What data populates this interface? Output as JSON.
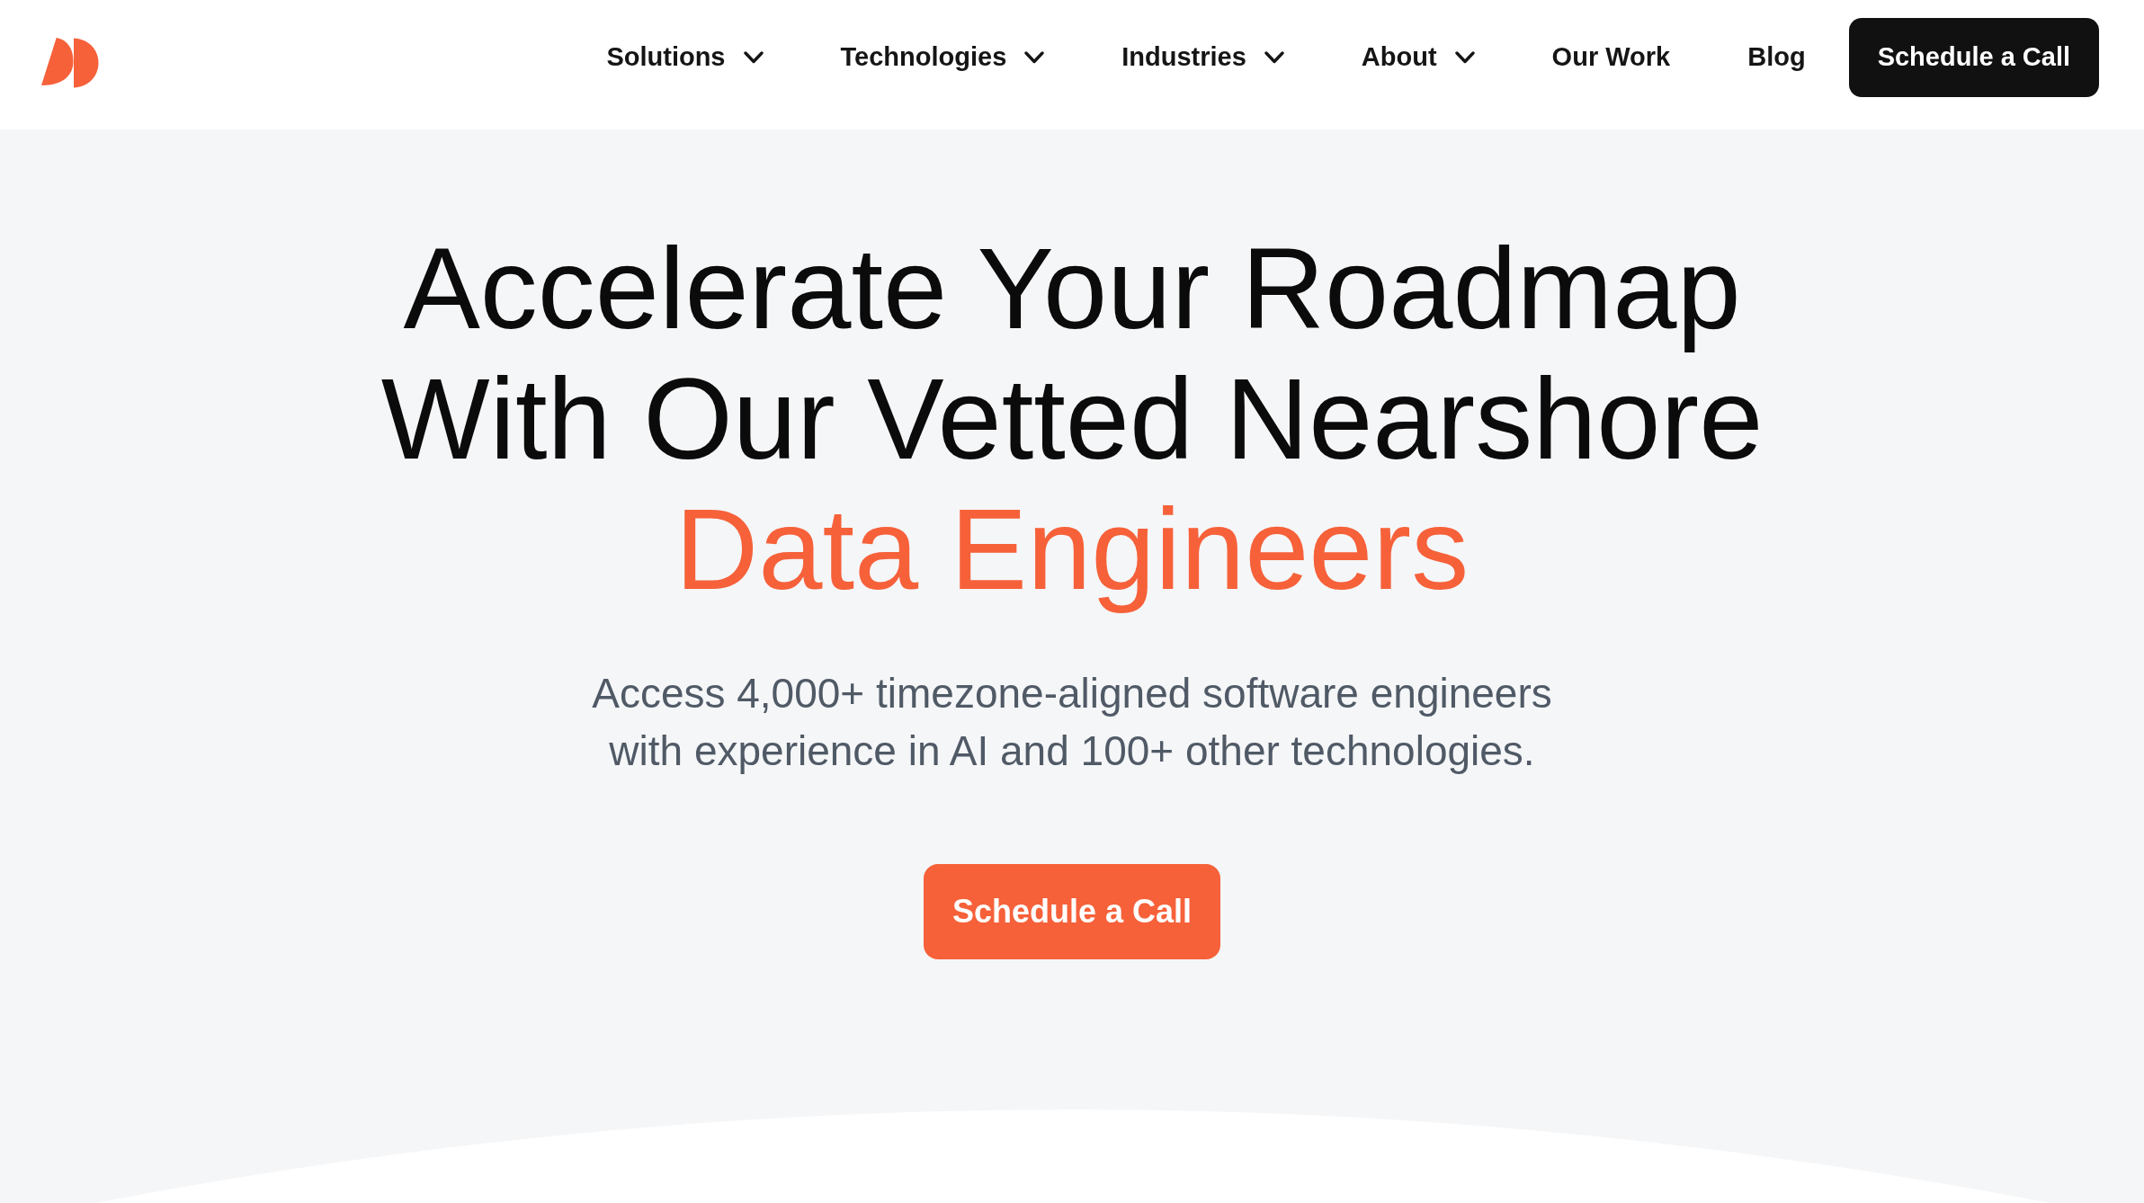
{
  "header": {
    "nav": [
      {
        "label": "Solutions",
        "kind": "dropdown"
      },
      {
        "label": "Technologies",
        "kind": "dropdown"
      },
      {
        "label": "Industries",
        "kind": "dropdown"
      },
      {
        "label": "About",
        "kind": "dropdown"
      },
      {
        "label": "Our Work",
        "kind": "link"
      },
      {
        "label": "Blog",
        "kind": "link"
      }
    ],
    "cta": "Schedule a Call"
  },
  "hero": {
    "headline_lines": [
      "Accelerate Your Roadmap",
      "With Our Vetted Nearshore"
    ],
    "headline_highlight": "Data Engineers",
    "subtitle_lines": [
      "Access 4,000+ timezone-aligned software engineers",
      "with experience in AI and 100+ other technologies."
    ],
    "cta": "Schedule a Call"
  }
}
